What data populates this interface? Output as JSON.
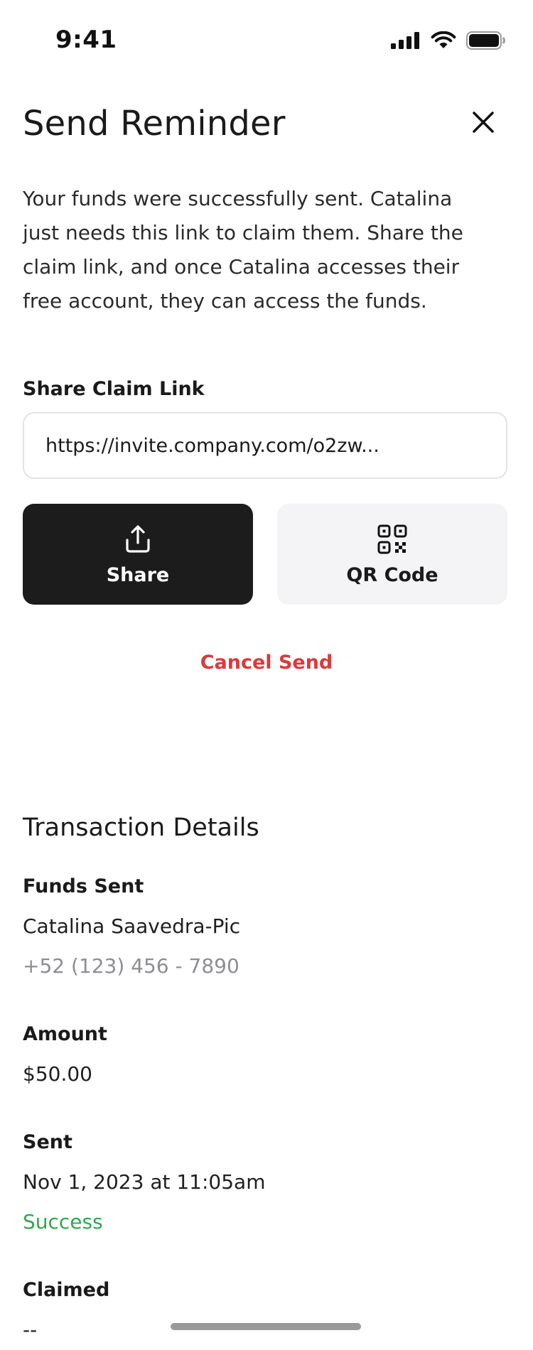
{
  "status_bar": {
    "time": "9:41",
    "icons": [
      "cellular-signal-icon",
      "wifi-icon",
      "battery-icon"
    ]
  },
  "header": {
    "title": "Send Reminder",
    "close_icon": "close-icon"
  },
  "intro": {
    "text": "Your funds were successfully sent. Catalina just needs this link to claim them. Share the claim link, and once Catalina accesses their free account, they can access the funds."
  },
  "claim_link": {
    "label": "Share Claim Link",
    "value": "https://invite.company.com/o2zw..."
  },
  "actions": {
    "share_label": "Share",
    "share_icon": "share-upload-icon",
    "qr_label": "QR Code",
    "qr_icon": "qr-code-icon",
    "cancel_label": "Cancel Send"
  },
  "transaction": {
    "title": "Transaction Details",
    "funds_sent_label": "Funds Sent",
    "recipient_name": "Catalina Saavedra-Pic",
    "recipient_phone": "+52 (123) 456 - 7890",
    "amount_label": "Amount",
    "amount_value": "$50.00",
    "sent_label": "Sent",
    "sent_value": "Nov 1, 2023 at 11:05am",
    "sent_status": "Success",
    "claimed_label": "Claimed",
    "claimed_value": "--"
  },
  "colors": {
    "primary_button": "#1c1c1c",
    "secondary_button": "#f4f4f6",
    "danger": "#d93b3b",
    "success": "#2fa84f",
    "muted_text": "#8d8d93"
  }
}
